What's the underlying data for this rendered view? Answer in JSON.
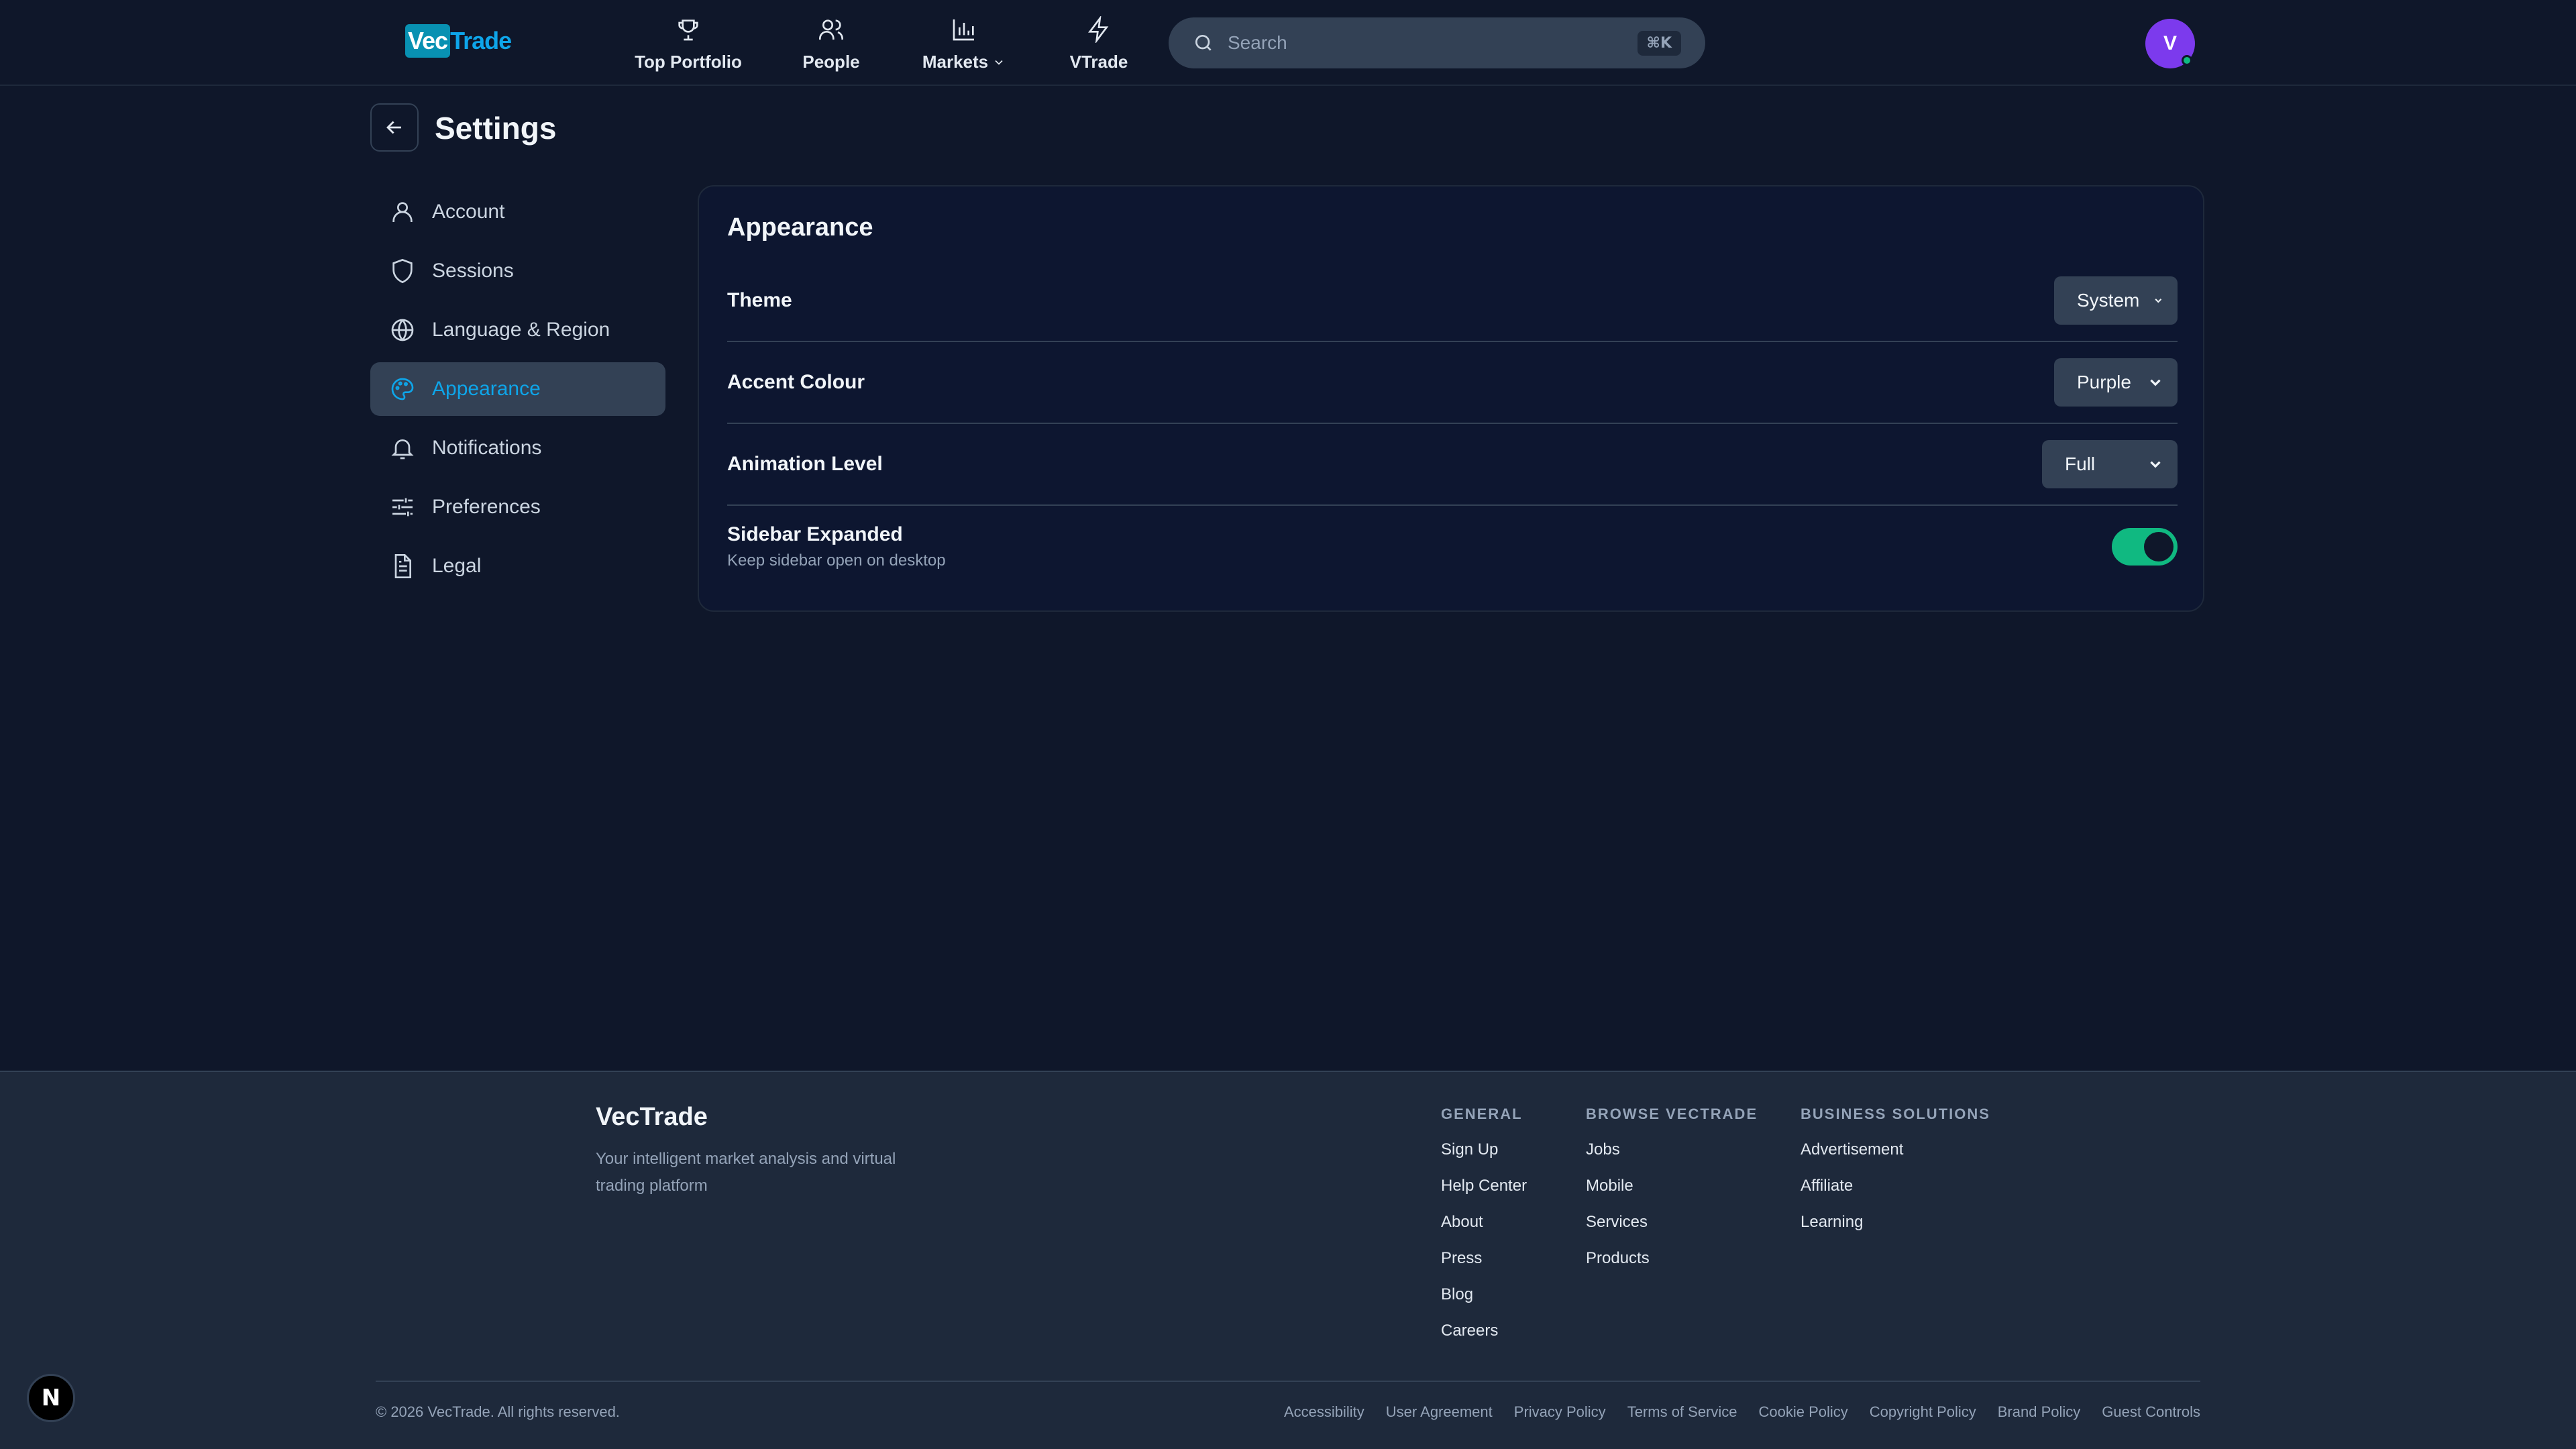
{
  "header": {
    "logo_left": "Vec",
    "logo_right": "Trade",
    "nav": [
      {
        "label": "Top Portfolio",
        "icon": "trophy-icon"
      },
      {
        "label": "People",
        "icon": "users-icon"
      },
      {
        "label": "Markets",
        "icon": "bar-chart-icon"
      },
      {
        "label": "VTrade",
        "icon": "lightning-icon"
      }
    ],
    "search_placeholder": "Search",
    "search_shortcut": "⌘K",
    "avatar_initial": "V"
  },
  "page": {
    "title": "Settings"
  },
  "sidebar": {
    "items": [
      {
        "label": "Account",
        "icon": "user-icon",
        "active": false
      },
      {
        "label": "Sessions",
        "icon": "shield-icon",
        "active": false
      },
      {
        "label": "Language & Region",
        "icon": "globe-icon",
        "active": false
      },
      {
        "label": "Appearance",
        "icon": "palette-icon",
        "active": true
      },
      {
        "label": "Notifications",
        "icon": "bell-icon",
        "active": false
      },
      {
        "label": "Preferences",
        "icon": "sliders-icon",
        "active": false
      },
      {
        "label": "Legal",
        "icon": "document-icon",
        "active": false
      }
    ]
  },
  "appearance": {
    "title": "Appearance",
    "theme": {
      "label": "Theme",
      "value": "System"
    },
    "accent": {
      "label": "Accent Colour",
      "value": "Purple"
    },
    "animation": {
      "label": "Animation Level",
      "value": "Full"
    },
    "sidebar_expanded": {
      "label": "Sidebar Expanded",
      "description": "Keep sidebar open on desktop",
      "enabled": true
    }
  },
  "footer": {
    "brand": "VecTrade",
    "tagline": "Your intelligent market analysis and virtual trading platform",
    "columns": [
      {
        "title": "GENERAL",
        "links": [
          "Sign Up",
          "Help Center",
          "About",
          "Press",
          "Blog",
          "Careers"
        ]
      },
      {
        "title": "BROWSE VECTRADE",
        "links": [
          "Jobs",
          "Mobile",
          "Services",
          "Products"
        ]
      },
      {
        "title": "BUSINESS SOLUTIONS",
        "links": [
          "Advertisement",
          "Affiliate",
          "Learning"
        ]
      }
    ],
    "copyright": "© 2026 VecTrade. All rights reserved.",
    "legal_links": [
      "Accessibility",
      "User Agreement",
      "Privacy Policy",
      "Terms of Service",
      "Cookie Policy",
      "Copyright Policy",
      "Brand Policy",
      "Guest Controls"
    ]
  },
  "badge": "N",
  "colors": {
    "accent": "#0ea5e9",
    "toggle_on": "#10b981",
    "avatar": "#7c3aed",
    "background": "#0f172a"
  }
}
